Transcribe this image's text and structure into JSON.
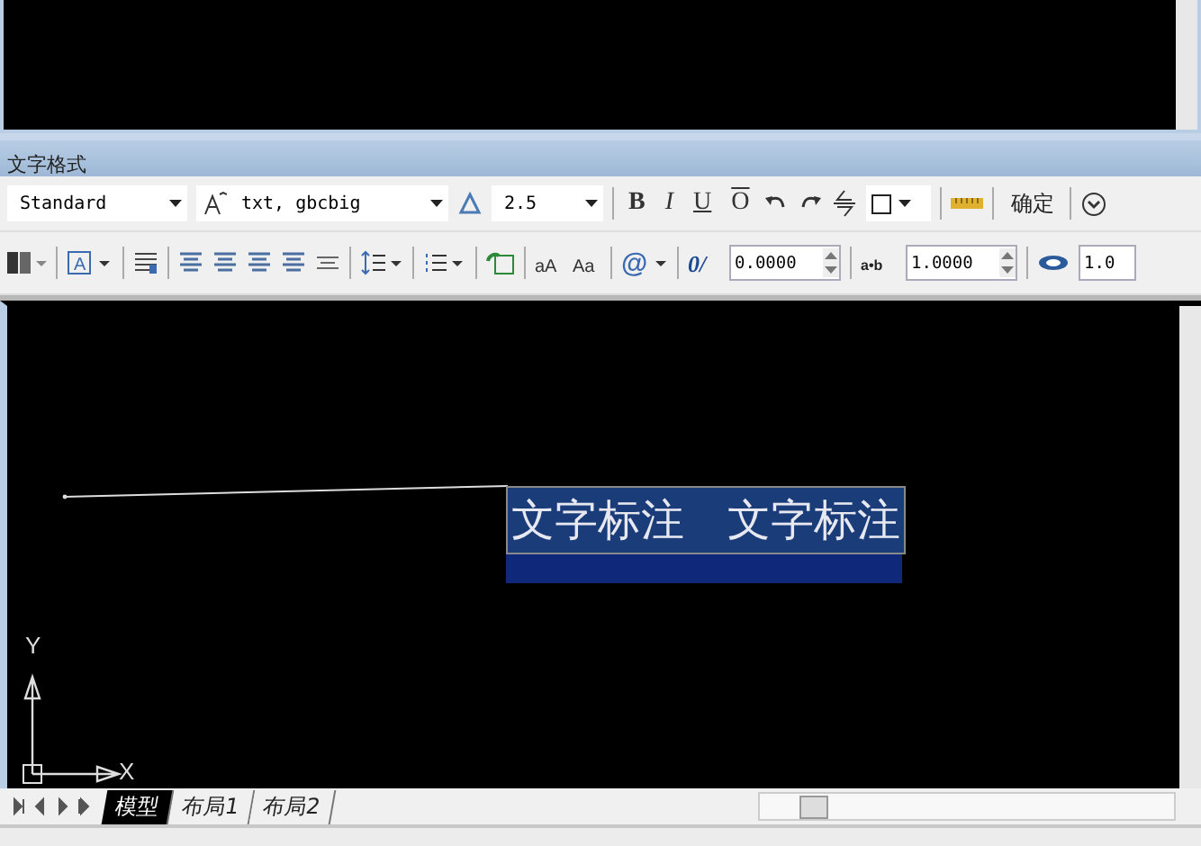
{
  "toolbar": {
    "title": "文字格式",
    "style_combo": "Standard",
    "font_combo": "txt, gbcbig",
    "height_combo": "2.5",
    "format_buttons": [
      {
        "label": "B",
        "kind": "bold"
      },
      {
        "label": "I",
        "kind": "italic"
      },
      {
        "label": "U",
        "kind": "underline"
      },
      {
        "label": "O",
        "kind": "overline"
      }
    ],
    "ok_button": "确定",
    "justify_glyph": "A",
    "uppercase_glyph": "aA",
    "lowercase_glyph": "Aa",
    "symbol_glyph": "@",
    "oblique_glyph": "0/",
    "tracking_glyph": "a•b",
    "oblique_value": "0.0000",
    "tracking_value": "1.0000",
    "width_value": "1.0"
  },
  "canvas": {
    "mtext": "文字标注　文字标注",
    "axis_x": "X",
    "axis_y": "Y"
  },
  "layout_tabs": [
    {
      "label": "模型",
      "selected": true
    },
    {
      "label": "布局1",
      "selected": false
    },
    {
      "label": "布局2",
      "selected": false
    }
  ]
}
